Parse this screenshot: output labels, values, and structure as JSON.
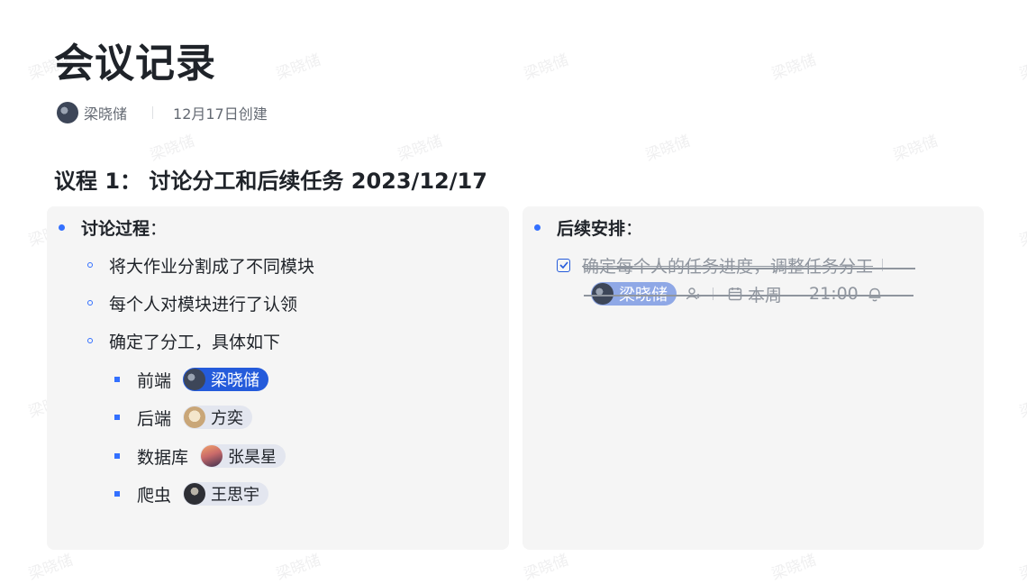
{
  "watermark": "梁晓储",
  "doc": {
    "title": "会议记录",
    "author": "梁晓储",
    "created": "12月17日创建"
  },
  "agenda": {
    "title": "议程 1： 讨论分工和后续任务 2023/12/17"
  },
  "left": {
    "heading": "讨论过程",
    "colon": "：",
    "items": [
      "将大作业分割成了不同模块",
      "每个人对模块进行了认领",
      "确定了分工，具体如下"
    ],
    "assignments": [
      {
        "module": "前端",
        "person": "梁晓储",
        "avatar_icon": "avatar-dark-icon"
      },
      {
        "module": "后端",
        "person": "方奕",
        "avatar_icon": "avatar-dog-icon"
      },
      {
        "module": "数据库",
        "person": "张昊星",
        "avatar_icon": "avatar-sunset-icon"
      },
      {
        "module": "爬虫",
        "person": "王思宇",
        "avatar_icon": "avatar-person-icon"
      }
    ]
  },
  "right": {
    "heading": "后续安排",
    "colon": "：",
    "task": {
      "text": "确定每个人的任务进度，调整任务分工",
      "completed": true,
      "assignee": "梁晓储",
      "due_label": "本周",
      "due_time": "21:00"
    }
  },
  "colors": {
    "accent": "#3370ff",
    "mention_primary": "#245bdb",
    "panel_bg": "#f5f5f5",
    "muted_text": "#8f959e"
  }
}
